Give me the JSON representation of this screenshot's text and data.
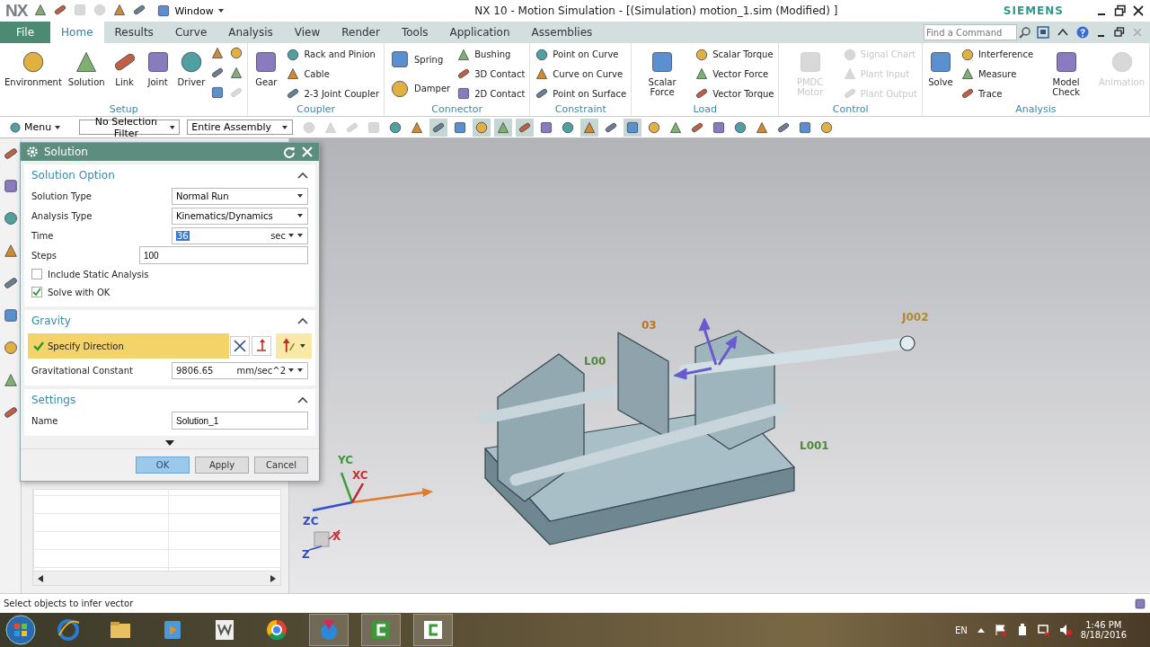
{
  "titlebar": {
    "logo": "NX",
    "window_menu": "Window",
    "title": "NX 10 - Motion Simulation - [(Simulation) motion_1.sim (Modified) ]",
    "brand": "SIEMENS"
  },
  "tabs": [
    {
      "label": "File",
      "kind": "file",
      "selected": false
    },
    {
      "label": "Home",
      "kind": "tab",
      "selected": true
    },
    {
      "label": "Results",
      "kind": "tab",
      "selected": false
    },
    {
      "label": "Curve",
      "kind": "tab",
      "selected": false
    },
    {
      "label": "Analysis",
      "kind": "tab",
      "selected": false
    },
    {
      "label": "View",
      "kind": "tab",
      "selected": false
    },
    {
      "label": "Render",
      "kind": "tab",
      "selected": false
    },
    {
      "label": "Tools",
      "kind": "tab",
      "selected": false
    },
    {
      "label": "Application",
      "kind": "tab",
      "selected": false
    },
    {
      "label": "Assemblies",
      "kind": "tab",
      "selected": false
    }
  ],
  "command_search": {
    "placeholder": "Find a Command"
  },
  "ribbon": [
    {
      "label": "Setup",
      "items": [
        {
          "kind": "large",
          "label": "Environment",
          "disabled": false
        },
        {
          "kind": "large",
          "label": "Solution",
          "disabled": false
        },
        {
          "kind": "large",
          "label": "Link",
          "disabled": false
        },
        {
          "kind": "large",
          "label": "Joint",
          "disabled": false
        },
        {
          "kind": "large",
          "label": "Driver",
          "disabled": false
        },
        {
          "kind": "icon",
          "disabled": false
        },
        {
          "kind": "icon",
          "disabled": false
        },
        {
          "kind": "icon",
          "disabled": false
        },
        {
          "kind": "icon",
          "disabled": false
        },
        {
          "kind": "icon",
          "disabled": false
        },
        {
          "kind": "icon",
          "disabled": true
        }
      ]
    },
    {
      "label": "Coupler",
      "items": [
        {
          "kind": "large",
          "label": "Gear",
          "disabled": false
        },
        {
          "kind": "small",
          "label": "Rack and Pinion",
          "disabled": false
        },
        {
          "kind": "small",
          "label": "Cable",
          "disabled": false
        },
        {
          "kind": "small",
          "label": "2-3 Joint Coupler",
          "disabled": false
        }
      ]
    },
    {
      "label": "Connector",
      "items": [
        {
          "kind": "side",
          "label": "Spring",
          "disabled": false
        },
        {
          "kind": "side",
          "label": "Damper",
          "disabled": false
        },
        {
          "kind": "small",
          "label": "Bushing",
          "disabled": false
        },
        {
          "kind": "small",
          "label": "3D Contact",
          "disabled": false
        },
        {
          "kind": "small",
          "label": "2D Contact",
          "disabled": false
        }
      ]
    },
    {
      "label": "Constraint",
      "items": [
        {
          "kind": "small",
          "label": "Point on Curve",
          "disabled": false
        },
        {
          "kind": "small",
          "label": "Curve on Curve",
          "disabled": false
        },
        {
          "kind": "small",
          "label": "Point on Surface",
          "disabled": false
        }
      ]
    },
    {
      "label": "Load",
      "items": [
        {
          "kind": "large",
          "label": "Scalar Force",
          "disabled": false
        },
        {
          "kind": "small",
          "label": "Scalar Torque",
          "disabled": false
        },
        {
          "kind": "small",
          "label": "Vector Force",
          "disabled": false
        },
        {
          "kind": "small",
          "label": "Vector Torque",
          "disabled": false
        }
      ]
    },
    {
      "label": "Control",
      "items": [
        {
          "kind": "large",
          "label": "PMDC Motor",
          "disabled": true
        },
        {
          "kind": "small",
          "label": "Signal Chart",
          "disabled": true
        },
        {
          "kind": "small",
          "label": "Plant Input",
          "disabled": true
        },
        {
          "kind": "small",
          "label": "Plant Output",
          "disabled": true
        }
      ]
    },
    {
      "label": "Analysis",
      "items": [
        {
          "kind": "large",
          "label": "Solve",
          "disabled": false
        },
        {
          "kind": "small",
          "label": "Interference",
          "disabled": false
        },
        {
          "kind": "small",
          "label": "Measure",
          "disabled": false
        },
        {
          "kind": "small",
          "label": "Trace",
          "disabled": false
        },
        {
          "kind": "large",
          "label": "Model Check",
          "disabled": false
        },
        {
          "kind": "large",
          "label": "Animation",
          "disabled": true
        }
      ]
    }
  ],
  "toolbar": {
    "menu": "Menu",
    "selection_filter": "No Selection Filter",
    "scope": "Entire Assembly",
    "icons": [
      {
        "pressed": false
      },
      {
        "pressed": false
      },
      {
        "pressed": false
      },
      {
        "pressed": false
      },
      {
        "pressed": false
      },
      {
        "pressed": false
      },
      {
        "pressed": true
      },
      {
        "pressed": false
      },
      {
        "pressed": true
      },
      {
        "pressed": true
      },
      {
        "pressed": true
      },
      {
        "pressed": false
      },
      {
        "pressed": false
      },
      {
        "pressed": true
      },
      {
        "pressed": false
      },
      {
        "pressed": true
      },
      {
        "pressed": false
      },
      {
        "pressed": false
      },
      {
        "pressed": false
      },
      {
        "pressed": false
      },
      {
        "pressed": false
      },
      {
        "pressed": false
      },
      {
        "pressed": false
      },
      {
        "pressed": false
      },
      {
        "pressed": false
      }
    ]
  },
  "dialog": {
    "title": "Solution",
    "sections": [
      {
        "title": "Solution Option",
        "expanded": true,
        "rows": [
          {
            "kind": "select",
            "label": "Solution Type",
            "value": "Normal Run"
          },
          {
            "kind": "select",
            "label": "Analysis Type",
            "value": "Kinematics/Dynamics"
          },
          {
            "kind": "unit",
            "label": "Time",
            "value": "36",
            "unit": "sec",
            "selected": true
          },
          {
            "kind": "text",
            "label": "Steps",
            "value": "100"
          },
          {
            "kind": "checkbox",
            "label": "Include Static Analysis",
            "checked": false
          },
          {
            "kind": "checkbox",
            "label": "Solve with OK",
            "checked": true
          }
        ]
      },
      {
        "title": "Gravity",
        "expanded": true,
        "rows": [
          {
            "kind": "vector",
            "label": "Specify Direction",
            "done": true
          },
          {
            "kind": "unit",
            "label": "Gravitational Constant",
            "value": "9806.65",
            "unit": "mm/sec^2",
            "selected": false
          }
        ]
      },
      {
        "title": "Settings",
        "expanded": true,
        "rows": [
          {
            "kind": "text",
            "label": "Name",
            "value": "Solution_1"
          }
        ]
      }
    ],
    "buttons": [
      {
        "label": "OK",
        "default": true
      },
      {
        "label": "Apply",
        "default": false
      },
      {
        "label": "Cancel",
        "default": false
      }
    ]
  },
  "viewport": {
    "labels": [
      {
        "text": "J002",
        "color": "#b08a30"
      },
      {
        "text": "03",
        "color": "#b87420"
      },
      {
        "text": "L00",
        "color": "#4f8a3a"
      },
      {
        "text": "L001",
        "color": "#4f8a3a"
      }
    ],
    "triad": [
      {
        "text": "YC",
        "color": "#3a9a3a"
      },
      {
        "text": "XC",
        "color": "#c83030"
      },
      {
        "text": "ZC",
        "color": "#3050c0"
      },
      {
        "text": "X",
        "color": "#c83030"
      },
      {
        "text": "Z",
        "color": "#3050c0"
      }
    ]
  },
  "status_bar": {
    "message": "Select objects to infer vector"
  },
  "taskbar": {
    "language": "EN",
    "time": "1:46 PM",
    "date": "8/18/2016"
  }
}
